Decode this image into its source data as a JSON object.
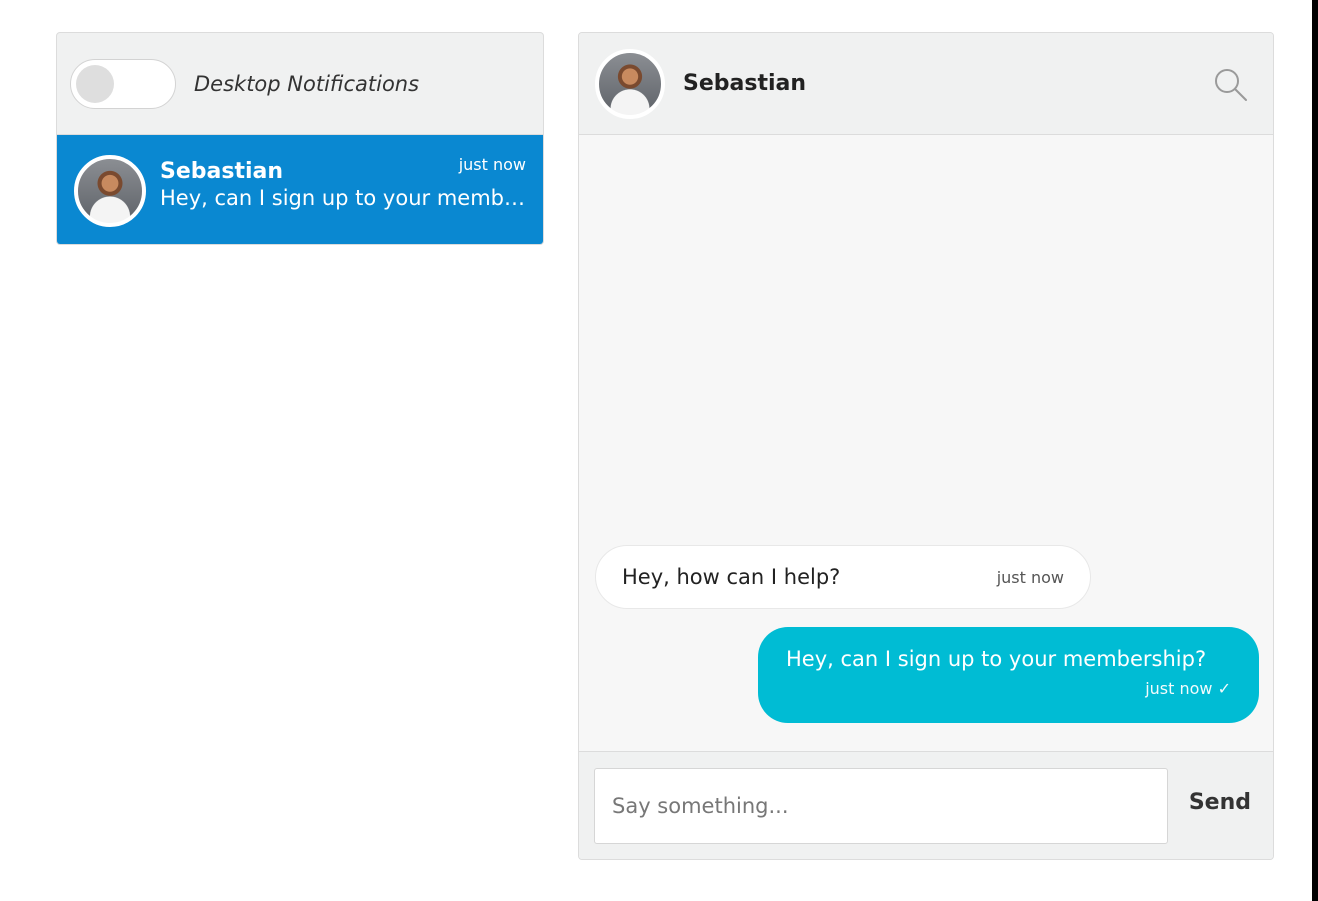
{
  "notifications": {
    "label": "Desktop Notifications",
    "enabled": false
  },
  "conversation_list": [
    {
      "name": "Sebastian",
      "preview": "Hey, can I sign up to your membe...",
      "time": "just now",
      "selected": true
    }
  ],
  "chat": {
    "title": "Sebastian",
    "messages": [
      {
        "direction": "incoming",
        "text": "Hey, how can I help?",
        "time": "just now"
      },
      {
        "direction": "outgoing",
        "text": "Hey, can I sign up to your membership?",
        "time": "just now ✓"
      }
    ],
    "composer": {
      "placeholder": "Say something...",
      "value": "",
      "send_label": "Send"
    }
  },
  "colors": {
    "selected_item": "#0a88d1",
    "outgoing_bubble": "#00bcd4",
    "panel_bg": "#f0f1f1"
  }
}
